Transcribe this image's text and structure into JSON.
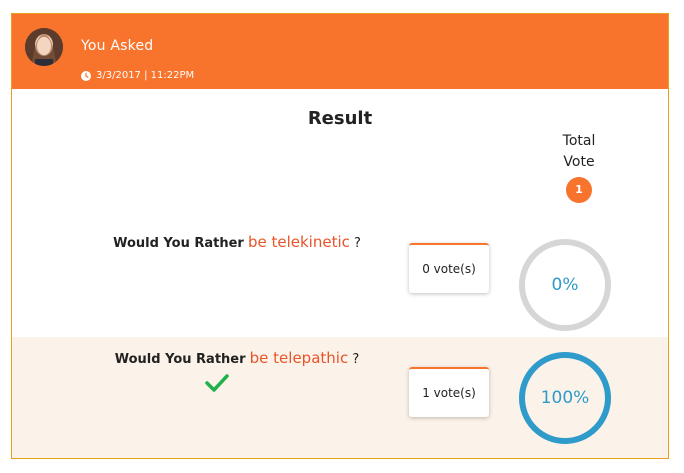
{
  "header": {
    "title": "You Asked",
    "timestamp": "3/3/2017 | 11:22PM",
    "avatar": "user-avatar-photo"
  },
  "result": {
    "title": "Result",
    "total_label_line1": "Total",
    "total_label_line2": "Vote",
    "total_count": "1"
  },
  "options": [
    {
      "prefix": "Would You Rather",
      "text": "be telekinetic",
      "suffix": "?",
      "votes_label": "0 vote(s)",
      "percent_label": "0%",
      "percent": 0,
      "selected": false
    },
    {
      "prefix": "Would You Rather",
      "text": "be telepathic",
      "suffix": "?",
      "votes_label": "1 vote(s)",
      "percent_label": "100%",
      "percent": 100,
      "selected": true
    }
  ],
  "colors": {
    "accent": "#f8732b",
    "option_text": "#e8542a",
    "gauge_fill": "#2e9bcb",
    "gauge_track": "#d6d6d6",
    "check": "#1fb14a",
    "selected_row_bg": "#fbf3e9"
  }
}
